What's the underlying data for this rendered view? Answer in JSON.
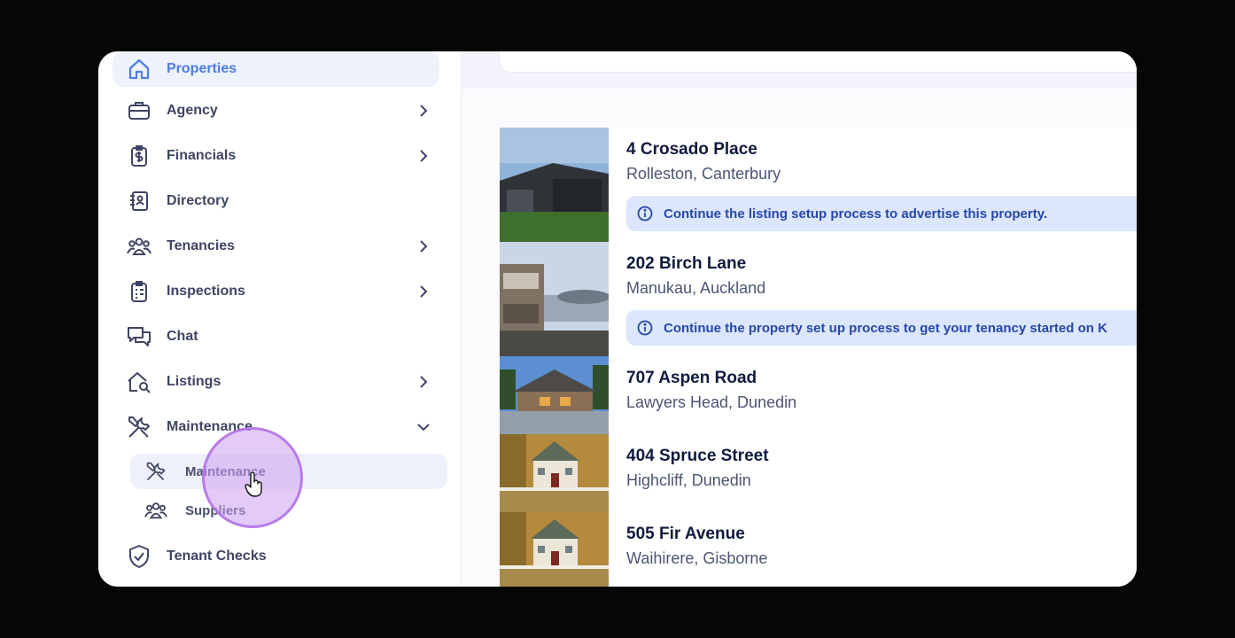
{
  "sidebar": {
    "items": [
      {
        "label": "Properties",
        "icon": "home-icon",
        "active": true,
        "chevron": false
      },
      {
        "label": "Agency",
        "icon": "briefcase-icon",
        "chevron": true
      },
      {
        "label": "Financials",
        "icon": "dollar-clipboard-icon",
        "chevron": true
      },
      {
        "label": "Directory",
        "icon": "address-book-icon",
        "chevron": false
      },
      {
        "label": "Tenancies",
        "icon": "people-group-icon",
        "chevron": true
      },
      {
        "label": "Inspections",
        "icon": "checklist-clipboard-icon",
        "chevron": true
      },
      {
        "label": "Chat",
        "icon": "chat-bubbles-icon",
        "chevron": false
      },
      {
        "label": "Listings",
        "icon": "house-search-icon",
        "chevron": true
      },
      {
        "label": "Maintenance",
        "icon": "tools-icon",
        "chevron": true,
        "expanded": true
      },
      {
        "label": "Tenant Checks",
        "icon": "shield-check-icon",
        "chevron": false
      }
    ],
    "maintenance_sub": [
      {
        "label": "Maintenance",
        "icon": "tools-icon",
        "active": true
      },
      {
        "label": "Suppliers",
        "icon": "people-group-icon"
      }
    ]
  },
  "properties": [
    {
      "title": "4 Crosado Place",
      "location": "Rolleston, Canterbury",
      "banner": "Continue the listing setup process to advertise this property."
    },
    {
      "title": "202 Birch Lane",
      "location": "Manukau, Auckland",
      "banner": "Continue the property set up process to get your tenancy started on K"
    },
    {
      "title": "707 Aspen Road",
      "location": "Lawyers Head, Dunedin"
    },
    {
      "title": "404 Spruce Street",
      "location": "Highcliff, Dunedin"
    },
    {
      "title": "505 Fir Avenue",
      "location": "Waihirere, Gisborne"
    }
  ],
  "colors": {
    "accent": "#4f7be6",
    "banner_bg": "#dce6fc",
    "banner_text": "#2648a8",
    "highlight": "#cea0f0"
  }
}
